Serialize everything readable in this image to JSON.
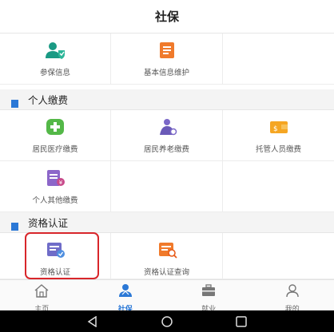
{
  "header": {
    "title": "社保"
  },
  "top_items": [
    {
      "label": "参保信息",
      "icon": "user-shield-icon"
    },
    {
      "label": "基本信息维护",
      "icon": "document-list-icon"
    }
  ],
  "section_payment": {
    "title": "个人缴费",
    "items": [
      {
        "label": "居民医疗缴费",
        "icon": "medical-cross-icon"
      },
      {
        "label": "居民养老缴费",
        "icon": "elderly-care-icon"
      },
      {
        "label": "托管人员缴费",
        "icon": "wallet-icon"
      },
      {
        "label": "个人其他缴费",
        "icon": "payment-form-icon"
      }
    ]
  },
  "section_qualification": {
    "title": "资格认证",
    "items": [
      {
        "label": "资格认证",
        "icon": "certification-icon"
      },
      {
        "label": "资格认证查询",
        "icon": "certification-search-icon"
      }
    ]
  },
  "tabbar": {
    "tabs": [
      {
        "label": "主页",
        "icon": "home-icon",
        "active": false
      },
      {
        "label": "社保",
        "icon": "social-security-icon",
        "active": true
      },
      {
        "label": "就业",
        "icon": "briefcase-icon",
        "active": false
      },
      {
        "label": "我的",
        "icon": "person-icon",
        "active": false
      }
    ]
  },
  "colors": {
    "accent_blue": "#2b78d6",
    "teal": "#22a58a",
    "green": "#54b848",
    "orange": "#f07a2b",
    "purple": "#7b68c8",
    "gold": "#f5a623",
    "highlight_red": "#d8262b"
  }
}
